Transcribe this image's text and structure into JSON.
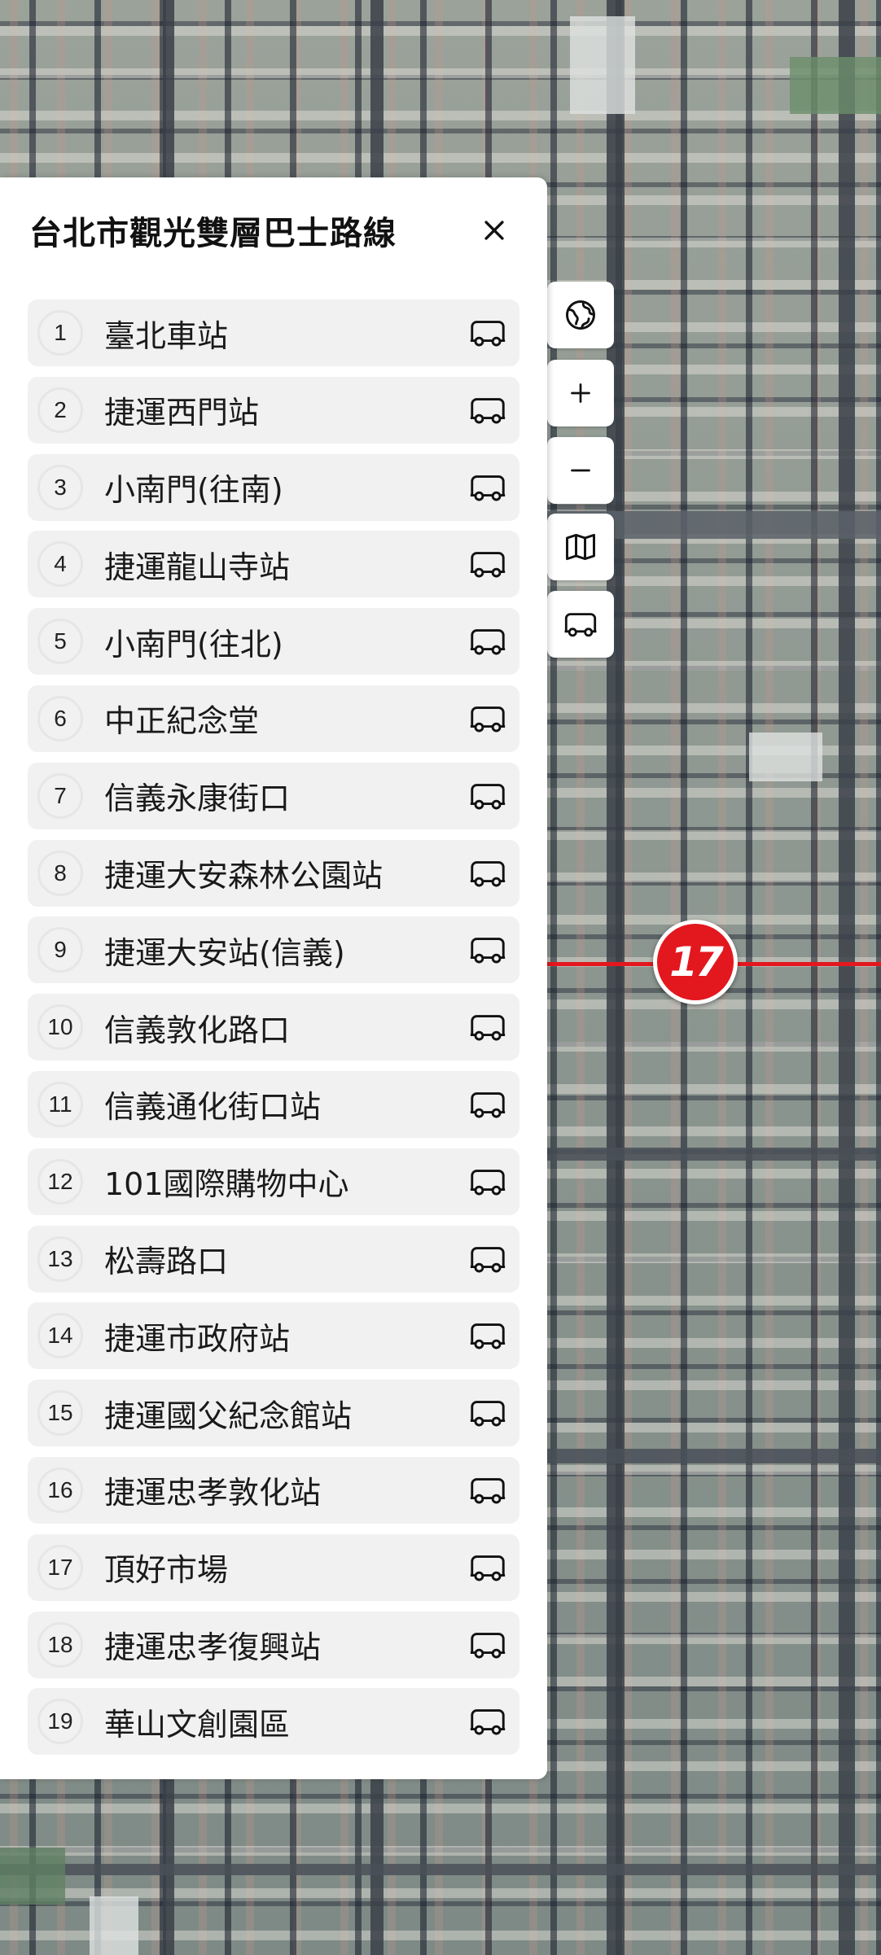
{
  "panel": {
    "title": "台北市觀光雙層巴士路線",
    "close_icon": "close-icon"
  },
  "stops": [
    {
      "num": "1",
      "name": "臺北車站"
    },
    {
      "num": "2",
      "name": "捷運西門站"
    },
    {
      "num": "3",
      "name": "小南門(往南)"
    },
    {
      "num": "4",
      "name": "捷運龍山寺站"
    },
    {
      "num": "5",
      "name": "小南門(往北)"
    },
    {
      "num": "6",
      "name": "中正紀念堂"
    },
    {
      "num": "7",
      "name": "信義永康街口"
    },
    {
      "num": "8",
      "name": "捷運大安森林公園站"
    },
    {
      "num": "9",
      "name": "捷運大安站(信義)"
    },
    {
      "num": "10",
      "name": "信義敦化路口"
    },
    {
      "num": "11",
      "name": "信義通化街口站"
    },
    {
      "num": "12",
      "name": "101國際購物中心"
    },
    {
      "num": "13",
      "name": "松壽路口"
    },
    {
      "num": "14",
      "name": "捷運市政府站"
    },
    {
      "num": "15",
      "name": "捷運國父紀念館站"
    },
    {
      "num": "16",
      "name": "捷運忠孝敦化站"
    },
    {
      "num": "17",
      "name": "頂好市場"
    },
    {
      "num": "18",
      "name": "捷運忠孝復興站"
    },
    {
      "num": "19",
      "name": "華山文創園區"
    }
  ],
  "map": {
    "current_stop_marker": "17",
    "controls": [
      "globe-icon",
      "zoom-in-icon",
      "zoom-out-icon",
      "map-layers-icon",
      "bus-icon"
    ],
    "route_color": "#e3171e"
  }
}
